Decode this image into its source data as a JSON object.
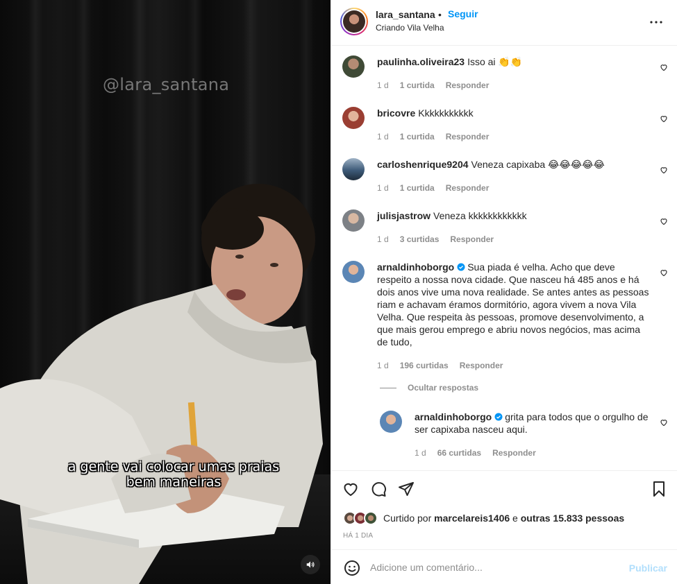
{
  "video": {
    "watermark": "@lara_santana",
    "caption_line1": "a gente vai colocar umas praias",
    "caption_line2": "bem maneiras"
  },
  "header": {
    "username": "lara_santana",
    "separator": "•",
    "follow_label": "Seguir",
    "location": "Criando Vila Velha"
  },
  "comments": [
    {
      "user": "paulinha.oliveira23",
      "text": "Isso ai 👏👏",
      "age": "1 d",
      "likes": "1 curtida",
      "reply": "Responder",
      "avatar_color": "#4a5a3f"
    },
    {
      "user": "bricovre",
      "text": "Kkkkkkkkkkk",
      "age": "1 d",
      "likes": "1 curtida",
      "reply": "Responder",
      "avatar_color": "#c46a5a"
    },
    {
      "user": "carloshenrique9204",
      "text": "Veneza capixaba 😂😂😂😂😂",
      "age": "1 d",
      "likes": "1 curtida",
      "reply": "Responder",
      "avatar_color": "#3d5a78"
    },
    {
      "user": "julisjastrow",
      "text": "Veneza kkkkkkkkkkkk",
      "age": "1 d",
      "likes": "3 curtidas",
      "reply": "Responder",
      "avatar_color": "#8a8d93"
    },
    {
      "user": "arnaldinhoborgo",
      "verified": true,
      "text": "Sua piada é velha. Acho que deve respeito a nossa nova cidade. Que nasceu há 485 anos e há dois anos vive uma nova realidade. Se antes antes as pessoas riam e achavam éramos dormitório, agora vivem a nova Vila Velha. Que respeita às pessoas, promove desenvolvimento, a que mais gerou emprego e abriu novos negócios, mas acima de tudo,",
      "age": "1 d",
      "likes": "196 curtidas",
      "reply": "Responder",
      "avatar_color": "#5b86b5"
    }
  ],
  "hide_replies_label": "Ocultar respostas",
  "reply": {
    "user": "arnaldinhoborgo",
    "verified": true,
    "text": "grita para todos que o orgulho de ser capixaba nasceu aqui.",
    "age": "1 d",
    "likes": "66 curtidas",
    "reply": "Responder",
    "avatar_color": "#5b86b5"
  },
  "likes_summary": {
    "prefix": "Curtido por",
    "user": "marcelareis1406",
    "connector": "e",
    "others": "outras 15.833 pessoas"
  },
  "posted_time": "HÁ 1 DIA",
  "add_comment": {
    "placeholder": "Adicione um comentário...",
    "publish_label": "Publicar"
  },
  "colors": {
    "accent": "#0095f6",
    "publish_disabled": "#b2dffc",
    "muted": "#8e8e8e"
  },
  "icons": [
    "heart-icon",
    "comment-icon",
    "share-icon",
    "bookmark-icon",
    "more-icon",
    "emoji-icon",
    "speaker-icon",
    "verified-icon"
  ]
}
